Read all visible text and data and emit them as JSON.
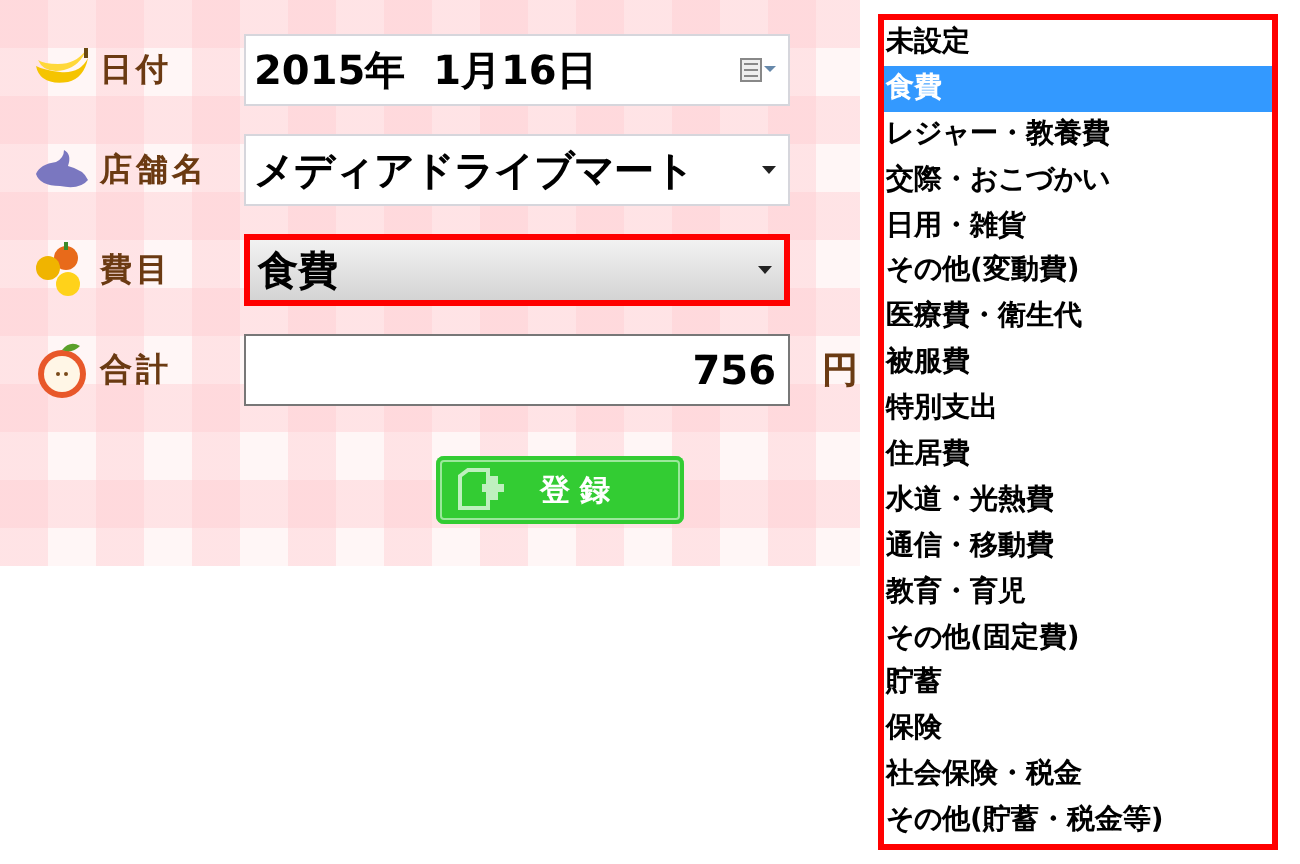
{
  "form": {
    "fields": [
      {
        "kind": "date",
        "label": "日付",
        "value": "2015年  1月16日",
        "highlighted": false
      },
      {
        "kind": "select",
        "label": "店舗名",
        "value": "メディアドライブマート",
        "highlighted": false
      },
      {
        "kind": "select",
        "label": "費目",
        "value": "食費",
        "highlighted": true
      },
      {
        "kind": "number",
        "label": "合計",
        "value": "756",
        "unit": "円",
        "highlighted": false
      }
    ],
    "submit": {
      "label": "登 録"
    }
  },
  "dropdown": {
    "highlighted": true,
    "items": [
      {
        "label": "未設定",
        "selected": false
      },
      {
        "label": "食費",
        "selected": true
      },
      {
        "label": "レジャー・教養費",
        "selected": false
      },
      {
        "label": "交際・おこづかい",
        "selected": false
      },
      {
        "label": "日用・雑貨",
        "selected": false
      },
      {
        "label": "その他(変動費)",
        "selected": false
      },
      {
        "label": "医療費・衛生代",
        "selected": false
      },
      {
        "label": "被服費",
        "selected": false
      },
      {
        "label": "特別支出",
        "selected": false
      },
      {
        "label": "住居費",
        "selected": false
      },
      {
        "label": "水道・光熱費",
        "selected": false
      },
      {
        "label": "通信・移動費",
        "selected": false
      },
      {
        "label": "教育・育児",
        "selected": false
      },
      {
        "label": "その他(固定費)",
        "selected": false
      },
      {
        "label": "貯蓄",
        "selected": false
      },
      {
        "label": "保険",
        "selected": false
      },
      {
        "label": "社会保険・税金",
        "selected": false
      },
      {
        "label": "その他(貯蓄・税金等)",
        "selected": false
      }
    ]
  }
}
